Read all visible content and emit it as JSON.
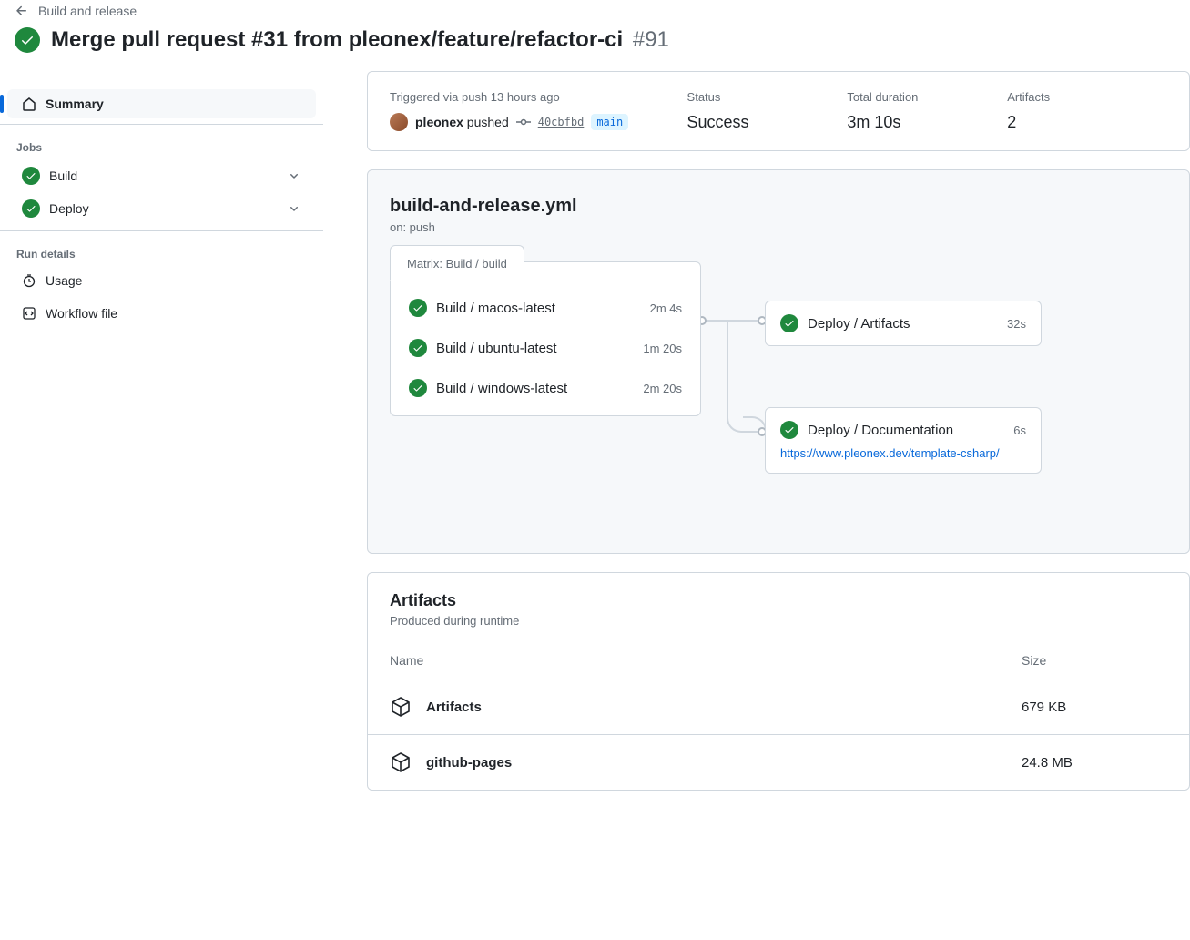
{
  "breadcrumb": {
    "workflow_name": "Build and release"
  },
  "title": {
    "text": "Merge pull request #31 from pleonex/feature/refactor-ci",
    "run_number": "#91"
  },
  "sidebar": {
    "summary_label": "Summary",
    "jobs_label": "Jobs",
    "jobs": [
      {
        "name": "Build"
      },
      {
        "name": "Deploy"
      }
    ],
    "run_details_label": "Run details",
    "usage_label": "Usage",
    "workflow_file_label": "Workflow file"
  },
  "info": {
    "triggered_label": "Triggered via push 13 hours ago",
    "actor": "pleonex",
    "pushed_word": "pushed",
    "commit_sha": "40cbfbd",
    "branch": "main",
    "status_label": "Status",
    "status_value": "Success",
    "duration_label": "Total duration",
    "duration_value": "3m 10s",
    "artifacts_label": "Artifacts",
    "artifacts_value": "2"
  },
  "workflow": {
    "file": "build-and-release.yml",
    "on": "on: push",
    "matrix_label": "Matrix: Build / build",
    "matrix_jobs": [
      {
        "name": "Build / macos-latest",
        "time": "2m 4s"
      },
      {
        "name": "Build / ubuntu-latest",
        "time": "1m 20s"
      },
      {
        "name": "Build / windows-latest",
        "time": "2m 20s"
      }
    ],
    "deploy_artifacts": {
      "name": "Deploy / Artifacts",
      "time": "32s"
    },
    "deploy_docs": {
      "name": "Deploy / Documentation",
      "time": "6s",
      "url": "https://www.pleonex.dev/template-csharp/"
    }
  },
  "artifacts": {
    "title": "Artifacts",
    "subtitle": "Produced during runtime",
    "col_name": "Name",
    "col_size": "Size",
    "rows": [
      {
        "name": "Artifacts",
        "size": "679 KB"
      },
      {
        "name": "github-pages",
        "size": "24.8 MB"
      }
    ]
  }
}
